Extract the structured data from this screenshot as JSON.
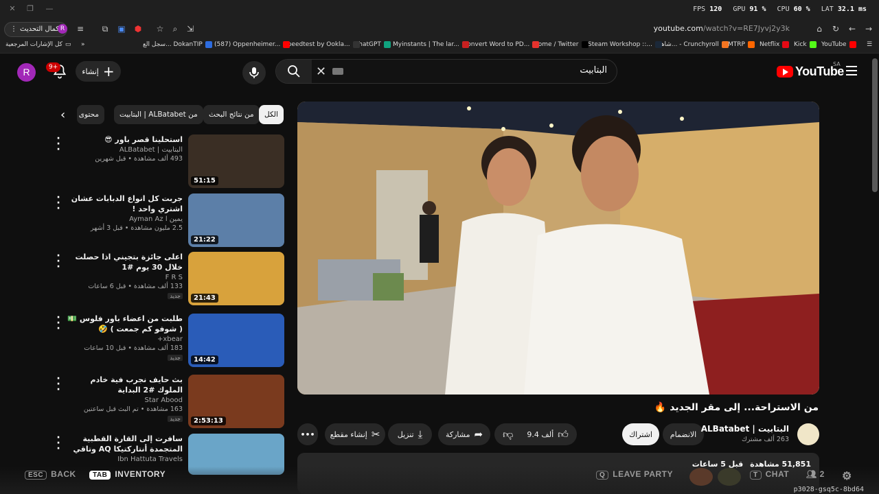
{
  "overlay": {
    "fps_label": "FPS",
    "fps": "120",
    "gpu_label": "GPU",
    "gpu": "91 %",
    "cpu_label": "CPU",
    "cpu": "60 %",
    "lat_label": "LAT",
    "lat": "32.1 ms"
  },
  "browser": {
    "update_label": "إكمال التحديث",
    "url_host": "youtube.com",
    "url_path": "/watch?v=RE7Jyvj2y3k",
    "bookmarks": [
      {
        "label": "YouTube",
        "color": "#ff0000"
      },
      {
        "label": "Kick",
        "color": "#53fc18"
      },
      {
        "label": "Netflix",
        "color": "#e50914"
      },
      {
        "label": "MTRP",
        "color": "#ff6600"
      },
      {
        "label": "شاهد... - Crunchyroll",
        "color": "#f47521"
      },
      {
        "label": "Steam Workshop ::...",
        "color": "#1b2838"
      },
      {
        "label": "Home / Twitter",
        "color": "#000000"
      },
      {
        "label": "Convert Word to PD...",
        "color": "#e5322d"
      },
      {
        "label": "Myinstants | The lar...",
        "color": "#c82020"
      },
      {
        "label": "ChatGPT",
        "color": "#10a37f"
      },
      {
        "label": "Speedtest by Ookla...",
        "color": "#333333"
      },
      {
        "label": "(587) Oppenheimer...",
        "color": "#ff0000"
      },
      {
        "label": "سجل الع... DokanTIP",
        "color": "#2d6cdf"
      }
    ],
    "all_bookmarks_label": "كل الإشارات المرجعية"
  },
  "header": {
    "avatar_letter": "R",
    "notif_count": "9+",
    "create_label": "إنشاء",
    "search_query": "البتابيت",
    "logo_text": "YouTube",
    "country_code": "SA"
  },
  "chips": [
    {
      "label": "الكل",
      "active": true
    },
    {
      "label": "من نتائج البحث"
    },
    {
      "label": "من ALBatabet | البتابيت"
    },
    {
      "label": "محتوى"
    }
  ],
  "recommendations": [
    {
      "title": "استحلينا قصر باور 😎",
      "channel": "البتابيت | ALBatabet",
      "stats": "493 ألف مشاهدة • قبل شهرين",
      "duration": "51:15",
      "new": false,
      "thumb": "#3a2e24"
    },
    {
      "title": "جربت كل انواع الدبابات عشان اشتري واحد !",
      "channel": "يمين ا Ayman Az",
      "stats": "2.5 مليون مشاهدة • قبل 3 أشهر",
      "duration": "21:22",
      "new": false,
      "thumb": "#5c7fa8"
    },
    {
      "title": "اعلى جائزة بتجيني اذا حصلت خلال 30 يوم #1",
      "channel": "F R S",
      "stats": "133 ألف مشاهدة • قبل 6 ساعات",
      "duration": "21:43",
      "new": true,
      "thumb": "#d8a23c"
    },
    {
      "title": "طلبت من اعضاء باور فلوس 💵 ( شوفو كم جمعت ) 🤣",
      "channel": "xbear+",
      "stats": "183 ألف مشاهدة • قبل 10 ساعات",
      "duration": "14:42",
      "new": true,
      "thumb": "#2a5cb8"
    },
    {
      "title": "بث حايف نجرب فية خادم الملوك #2 البداية",
      "channel": "Star Abood",
      "stats": "163 مشاهدة • تم البث قبل ساعتين",
      "duration": "2:53:13",
      "new": true,
      "thumb": "#7a3a1e"
    },
    {
      "title": "سافرت إلى القارة القطبية المتجمدة أنتاركتيكا AQ وتاقي التجربة كاملة",
      "channel": "Ibn Hattuta Travels",
      "stats": "",
      "duration": "",
      "new": false,
      "thumb": "#6aa5c8"
    }
  ],
  "video": {
    "title": "من الاستراحة... إلى مقر الجديد 🔥",
    "channel_name": "البتابيت | ALBatabet",
    "subscribers": "263 ألف مشترك",
    "join_label": "الانضمام",
    "subscribe_label": "اشتراك",
    "likes": "9.4 ألف",
    "share_label": "مشاركة",
    "download_label": "تنزيل",
    "clip_label": "إنشاء مقطع",
    "views": "51,851 مشاهدة",
    "uploaded": "قبل 5 ساعات"
  },
  "game_overlay": {
    "back_key": "ESC",
    "back_label": "BACK",
    "inv_key": "TAB",
    "inv_label": "INVENTORY",
    "leave_key": "Q",
    "leave_label": "LEAVE PARTY",
    "chat_key": "T",
    "chat_label": "CHAT",
    "party_count": "2"
  },
  "session_id": "p3028-gsq5c-8bd64"
}
